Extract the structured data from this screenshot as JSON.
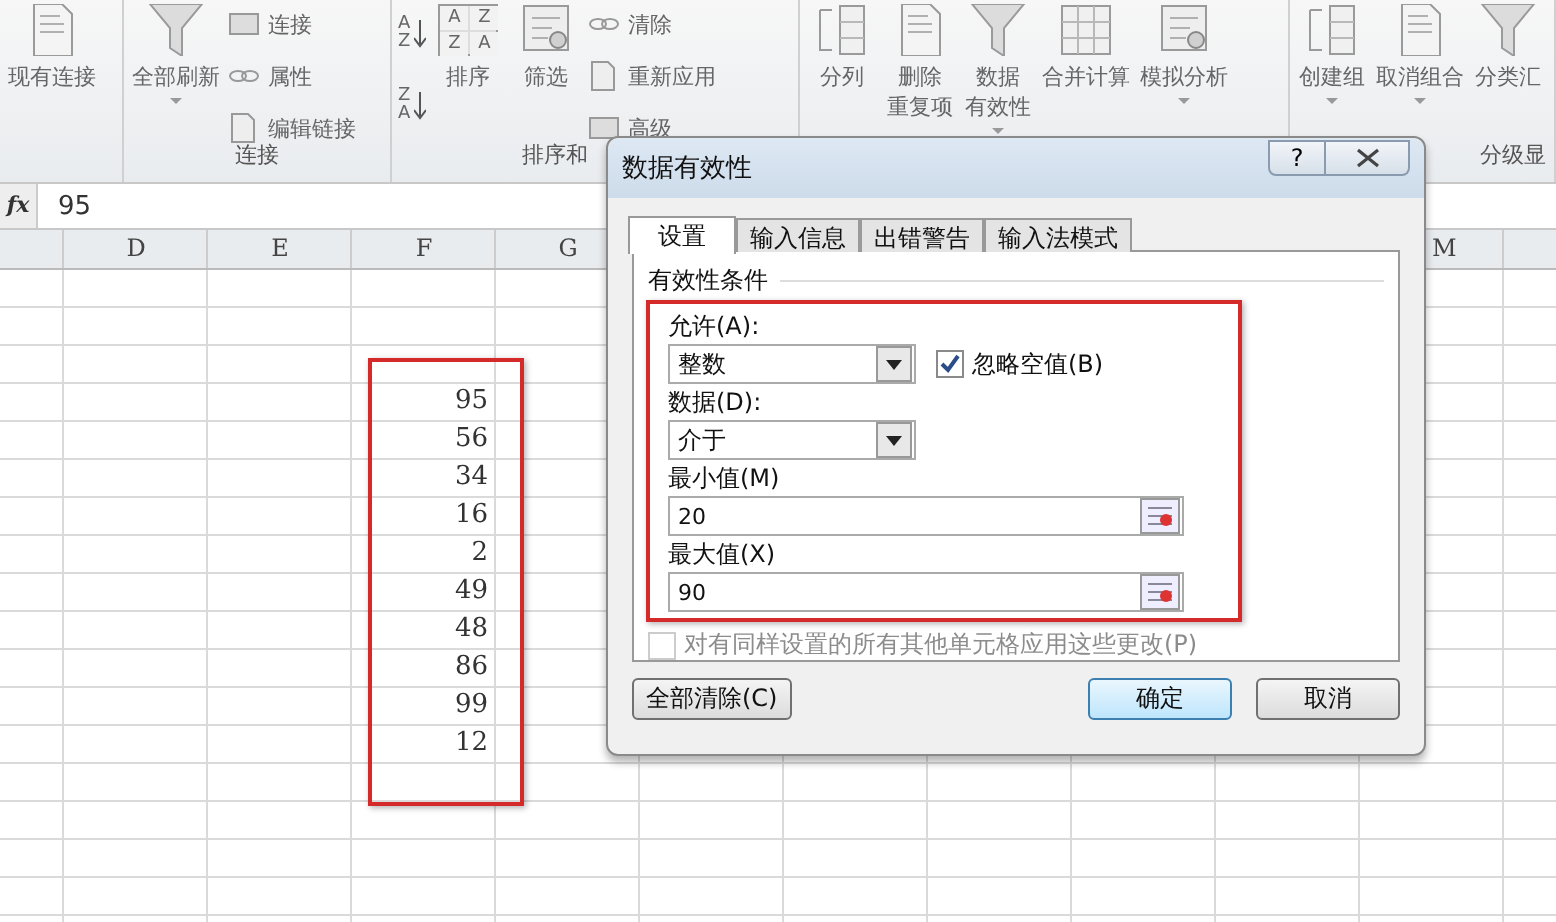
{
  "ribbon": {
    "groups": [
      {
        "items": [
          {
            "kind": "large",
            "label": "现有连接",
            "dropdown": false
          }
        ]
      },
      {
        "label": "连接",
        "items": [
          {
            "kind": "large",
            "label": "全部刷新",
            "dropdown": true
          },
          {
            "kind": "small_column",
            "entries": [
              "连接",
              "属性",
              "编辑链接"
            ]
          }
        ]
      },
      {
        "label": "排序和",
        "items": [
          {
            "kind": "sort_column",
            "buttons": [
              {
                "top": "A",
                "bottom": "Z"
              },
              {
                "top": "Z",
                "bottom": "A"
              }
            ]
          },
          {
            "kind": "large",
            "label": "排序",
            "dropdown": false,
            "grid_letters": [
              "A",
              "Z",
              "Z",
              "A"
            ]
          },
          {
            "kind": "large",
            "label": "筛选",
            "dropdown": false
          },
          {
            "kind": "small_column",
            "entries": [
              "清除",
              "重新应用",
              "高级"
            ]
          }
        ]
      },
      {
        "items": [
          {
            "kind": "large",
            "label": "分列",
            "dropdown": false
          },
          {
            "kind": "large",
            "label": "删除",
            "label_line_2": "重复项",
            "dropdown": false
          },
          {
            "kind": "large",
            "label": "数据",
            "label_line_2": "有效性",
            "dropdown": true
          },
          {
            "kind": "large",
            "label": "合并计算",
            "dropdown": false
          },
          {
            "kind": "large",
            "label": "模拟分析",
            "dropdown": true
          }
        ]
      },
      {
        "label": "分级显",
        "items": [
          {
            "kind": "large",
            "label": "创建组",
            "dropdown": true
          },
          {
            "kind": "large",
            "label": "取消组合",
            "dropdown": true
          },
          {
            "kind": "large",
            "label": "分类汇",
            "dropdown": false
          }
        ]
      }
    ]
  },
  "formula_bar": {
    "fx": "fx",
    "value": "95"
  },
  "sheet": {
    "headers_left": [
      "D",
      "E",
      "F",
      "G"
    ],
    "headers_right": [
      "M"
    ],
    "column_F_values": [
      "95",
      "56",
      "34",
      "16",
      "2",
      "49",
      "48",
      "86",
      "99",
      "12"
    ]
  },
  "dialog": {
    "title": "数据有效性",
    "help_button": "?",
    "tabs": [
      {
        "label": "设置",
        "selected": true
      },
      {
        "label": "输入信息",
        "selected": false
      },
      {
        "label": "出错警告",
        "selected": false
      },
      {
        "label": "输入法模式",
        "selected": false
      }
    ],
    "section_title": "有效性条件",
    "allow": {
      "label": "允许(A):",
      "value": "整数"
    },
    "ignore_blank": {
      "label": "忽略空值(B)",
      "checked": true
    },
    "data": {
      "label": "数据(D):",
      "value": "介于"
    },
    "minimum": {
      "label": "最小值(M)",
      "value": "20"
    },
    "maximum": {
      "label": "最大值(X)",
      "value": "90"
    },
    "apply_all": {
      "label": "对有同样设置的所有其他单元格应用这些更改(P)",
      "checked": false,
      "disabled": true
    },
    "buttons": [
      {
        "label": "全部清除(C)",
        "kind": "normal"
      },
      {
        "label": "确定",
        "kind": "default"
      },
      {
        "label": "取消",
        "kind": "normal"
      }
    ]
  }
}
